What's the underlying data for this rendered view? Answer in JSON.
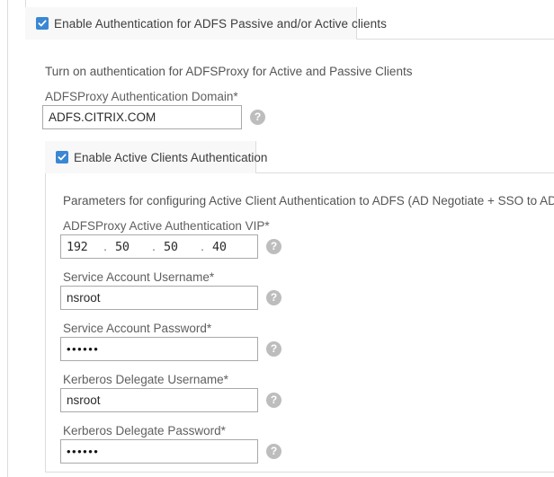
{
  "outer_section": {
    "tab_label": "Enable Authentication for ADFS Passive and/or Active clients",
    "checkbox_checked": true,
    "intro_text": "Turn on authentication for ADFSProxy for Active and Passive Clients",
    "domain_field": {
      "label": "ADFSProxy Authentication Domain*",
      "value": "ADFS.CITRIX.COM",
      "help_glyph": "?"
    }
  },
  "inner_section": {
    "tab_label": "Enable Active Clients Authentication",
    "checkbox_checked": true,
    "intro_text": "Parameters for configuring Active Client Authentication to ADFS (AD Negotiate + SSO to ADFS)",
    "fields": [
      {
        "name": "active-authentication-vip",
        "label": "ADFSProxy Active Authentication VIP*",
        "type": "ip",
        "octets": [
          "192",
          "50",
          "50",
          "40"
        ],
        "separator": ".",
        "help_glyph": "?"
      },
      {
        "name": "service-account-username",
        "label": "Service Account Username*",
        "type": "text",
        "value": "nsroot",
        "help_glyph": "?"
      },
      {
        "name": "service-account-password",
        "label": "Service Account Password*",
        "type": "password",
        "value": "••••••",
        "help_glyph": "?"
      },
      {
        "name": "kerberos-delegate-username",
        "label": "Kerberos Delegate Username*",
        "type": "text",
        "value": "nsroot",
        "help_glyph": "?"
      },
      {
        "name": "kerberos-delegate-password",
        "label": "Kerberos Delegate Password*",
        "type": "password",
        "value": "••••••",
        "help_glyph": "?"
      }
    ]
  },
  "colors": {
    "checkbox_blue": "#3a87d4",
    "tab_background": "#f8f8f8",
    "border_gray": "#dcdcdc",
    "input_border": "#a9a9a9",
    "label_text": "#5f5f5f",
    "help_circle": "#bdbdbd"
  }
}
